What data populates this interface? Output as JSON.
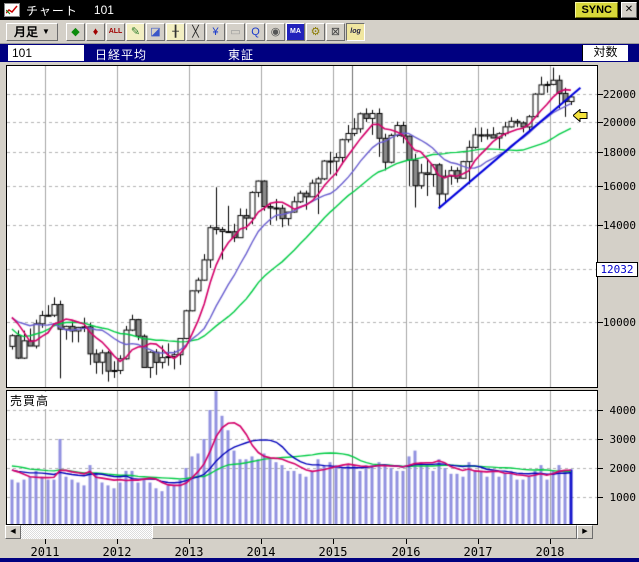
{
  "window": {
    "app_title": "チャート",
    "title_code": "101",
    "sync_label": "SYNC",
    "close_glyph": "✕"
  },
  "toolbar": {
    "interval_label": "月足",
    "dropdown_arrow": "▼",
    "icons": [
      {
        "name": "bar-width-expand-icon",
        "glyph": "◆",
        "color": "#0b8a0b",
        "bg": "#d4d0c8"
      },
      {
        "name": "bar-width-shrink-icon",
        "glyph": "♦",
        "color": "#a00000",
        "bg": "#d4d0c8"
      },
      {
        "name": "show-all-icon",
        "glyph": "ALL",
        "color": "#a00000",
        "bg": "#d4d0c8",
        "small": true
      },
      {
        "name": "draw-pencil-icon",
        "glyph": "✎",
        "color": "#2a7a2a",
        "bg": "#f3efc2"
      },
      {
        "name": "eraser-icon",
        "glyph": "◪",
        "color": "#3a56c8",
        "bg": "#d4d0c8"
      },
      {
        "name": "grid-cross-icon",
        "glyph": "╂",
        "color": "#333333",
        "bg": "#f3efc2"
      },
      {
        "name": "trendline-tool-icon",
        "glyph": "╳",
        "color": "#222222",
        "bg": "#d4d0c8"
      },
      {
        "name": "yen-scale-icon",
        "glyph": "¥",
        "color": "#1a3acc",
        "bg": "#d4d0c8"
      },
      {
        "name": "slider-icon",
        "glyph": "▭",
        "color": "#9a9a9a",
        "bg": "#d4d0c8"
      },
      {
        "name": "zoom-search-icon",
        "glyph": "Q",
        "color": "#1a3acc",
        "bg": "#d4d0c8"
      },
      {
        "name": "globe-settings-icon",
        "glyph": "◉",
        "color": "#555555",
        "bg": "#d4d0c8"
      },
      {
        "name": "ma-icon",
        "glyph": "MA",
        "color": "#ffffff",
        "bg": "#2222bb",
        "small": true
      },
      {
        "name": "settings-gears-icon",
        "glyph": "⚙",
        "color": "#8a7a00",
        "bg": "#d4d0c8"
      },
      {
        "name": "flag-tool-icon",
        "glyph": "⊠",
        "color": "#444444",
        "bg": "#d4d0c8"
      },
      {
        "name": "log-scale-icon",
        "glyph": "log",
        "color": "#222244",
        "bg": "#f0e6a0",
        "small": true,
        "pressed": true
      }
    ]
  },
  "header": {
    "code": "101",
    "name": "日経平均",
    "exchange": "東証",
    "scale_label": "対数"
  },
  "volume_panel": {
    "label": "売買高"
  },
  "scrollbar": {
    "left_arrow": "◀",
    "right_arrow": "▶"
  },
  "chart_data": {
    "type": "candlestick+volume",
    "title": "日経平均 月足 東証 (対数)",
    "scale": "log",
    "start": "2010-07",
    "ohlcv": [
      [
        9191,
        9585,
        9091,
        9537,
        1600
      ],
      [
        9537,
        9714,
        8796,
        8824,
        1500
      ],
      [
        8824,
        9704,
        8797,
        9369,
        1600
      ],
      [
        9369,
        9777,
        9202,
        9202,
        1700
      ],
      [
        9202,
        10080,
        9123,
        9937,
        1900
      ],
      [
        9937,
        10394,
        9800,
        10229,
        1700
      ],
      [
        10229,
        10600,
        10183,
        10237,
        1600
      ],
      [
        10237,
        10891,
        10175,
        10624,
        1600
      ],
      [
        10624,
        10768,
        8227,
        9755,
        3000
      ],
      [
        9755,
        9870,
        9405,
        9850,
        1700
      ],
      [
        9850,
        10017,
        9318,
        9694,
        1600
      ],
      [
        9694,
        9830,
        9319,
        9816,
        1500
      ],
      [
        9816,
        10151,
        9659,
        9833,
        1400
      ],
      [
        9833,
        9980,
        8619,
        8955,
        2100
      ],
      [
        8955,
        9098,
        8360,
        8700,
        1800
      ],
      [
        8700,
        9086,
        8343,
        8988,
        1500
      ],
      [
        8988,
        9050,
        8135,
        8435,
        1400
      ],
      [
        8435,
        8729,
        8239,
        8455,
        1300
      ],
      [
        8455,
        8911,
        8349,
        8803,
        1500
      ],
      [
        8803,
        9866,
        8780,
        9723,
        1900
      ],
      [
        9723,
        10255,
        9688,
        10084,
        1900
      ],
      [
        10084,
        10109,
        9388,
        9521,
        1500
      ],
      [
        9521,
        9580,
        8530,
        8543,
        1600
      ],
      [
        8543,
        9036,
        8238,
        9007,
        1500
      ],
      [
        9007,
        9104,
        8328,
        8695,
        1300
      ],
      [
        8695,
        9222,
        8513,
        8840,
        1200
      ],
      [
        8840,
        9288,
        8596,
        8870,
        1400
      ],
      [
        8870,
        9055,
        8488,
        8928,
        1400
      ],
      [
        8928,
        9446,
        8620,
        9446,
        1600
      ],
      [
        9446,
        10433,
        9420,
        10395,
        2000
      ],
      [
        10395,
        11150,
        10380,
        11139,
        2400
      ],
      [
        11139,
        11662,
        11046,
        11559,
        2500
      ],
      [
        11559,
        12650,
        11542,
        12398,
        3000
      ],
      [
        12398,
        13983,
        12056,
        13861,
        4000
      ],
      [
        13861,
        15943,
        13541,
        13775,
        4650
      ],
      [
        13775,
        13889,
        12415,
        13677,
        3800
      ],
      [
        13677,
        14953,
        13613,
        13668,
        3300
      ],
      [
        13668,
        14050,
        13188,
        13389,
        2600
      ],
      [
        13389,
        14817,
        13380,
        14456,
        2300
      ],
      [
        14456,
        14799,
        13748,
        14328,
        2300
      ],
      [
        14328,
        15727,
        14026,
        15662,
        2400
      ],
      [
        15662,
        16320,
        15407,
        16291,
        2300
      ],
      [
        16291,
        16330,
        14699,
        14915,
        2500
      ],
      [
        14915,
        15080,
        13995,
        14841,
        2300
      ],
      [
        14841,
        15312,
        14203,
        14828,
        2200
      ],
      [
        14828,
        15004,
        13885,
        14304,
        2100
      ],
      [
        14304,
        14637,
        13964,
        14632,
        1900
      ],
      [
        14632,
        15442,
        14601,
        15162,
        1900
      ],
      [
        15162,
        15759,
        15101,
        15621,
        1800
      ],
      [
        15621,
        15760,
        14753,
        15425,
        1700
      ],
      [
        15425,
        16374,
        15421,
        16174,
        1900
      ],
      [
        16174,
        16533,
        14529,
        16414,
        2300
      ],
      [
        16414,
        17520,
        16345,
        17460,
        2100
      ],
      [
        17460,
        18030,
        16672,
        17451,
        2200
      ],
      [
        17451,
        17951,
        16592,
        17674,
        2100
      ],
      [
        17674,
        18865,
        17268,
        18798,
        2000
      ],
      [
        18798,
        19778,
        18617,
        19207,
        2100
      ],
      [
        19207,
        20252,
        19034,
        19520,
        2100
      ],
      [
        19520,
        20655,
        19257,
        20563,
        1900
      ],
      [
        20563,
        20952,
        19990,
        20236,
        2100
      ],
      [
        20236,
        20841,
        19115,
        20585,
        2100
      ],
      [
        20585,
        20946,
        17714,
        18890,
        2200
      ],
      [
        18890,
        19192,
        16901,
        17388,
        2100
      ],
      [
        17388,
        19202,
        17320,
        19083,
        2000
      ],
      [
        19083,
        20012,
        18976,
        19747,
        1900
      ],
      [
        19747,
        20012,
        18565,
        19034,
        1900
      ],
      [
        19034,
        19058,
        16017,
        17518,
        2400
      ],
      [
        17518,
        17905,
        14865,
        16027,
        2600
      ],
      [
        16027,
        17291,
        15857,
        16759,
        2200
      ],
      [
        16759,
        17613,
        15471,
        16666,
        2100
      ],
      [
        16666,
        17251,
        15975,
        17235,
        1900
      ],
      [
        17235,
        17335,
        14864,
        15576,
        2300
      ],
      [
        15576,
        16938,
        15106,
        16569,
        2000
      ],
      [
        16569,
        17156,
        16083,
        16887,
        1800
      ],
      [
        16887,
        17081,
        16201,
        16450,
        1800
      ],
      [
        16450,
        17473,
        16436,
        17425,
        1700
      ],
      [
        17425,
        18746,
        16111,
        18308,
        2200
      ],
      [
        18308,
        19592,
        18224,
        19114,
        1900
      ],
      [
        19114,
        19615,
        18650,
        19041,
        1900
      ],
      [
        19041,
        19519,
        18805,
        19119,
        1700
      ],
      [
        19119,
        19633,
        18909,
        18909,
        1900
      ],
      [
        18909,
        19289,
        18224,
        19197,
        1700
      ],
      [
        19197,
        19998,
        19021,
        19651,
        1800
      ],
      [
        19651,
        20318,
        19610,
        20033,
        1900
      ],
      [
        20033,
        20195,
        19655,
        19925,
        1600
      ],
      [
        19925,
        20038,
        19280,
        19646,
        1600
      ],
      [
        19646,
        20481,
        19239,
        20356,
        1700
      ],
      [
        20356,
        22086,
        20328,
        22012,
        1900
      ],
      [
        22012,
        23382,
        21972,
        22725,
        2100
      ],
      [
        22725,
        23005,
        22119,
        22765,
        1600
      ],
      [
        22765,
        24129,
        22700,
        23098,
        1900
      ],
      [
        23098,
        23498,
        20950,
        22068,
        2100
      ],
      [
        22068,
        22502,
        20347,
        21454,
        1900
      ],
      [
        21454,
        21900,
        21200,
        21800,
        1950
      ]
    ],
    "ma_price": {
      "short_period": 6,
      "mid_period": 12,
      "long_period": 24,
      "seed_closes": [
        13377,
        13073,
        11260,
        8577,
        8512,
        8860,
        7994,
        7568,
        8110,
        8828,
        9523,
        9958,
        10357,
        10493,
        10133,
        10035,
        9346,
        10546,
        10198,
        10126,
        11090,
        11057,
        9769,
        9383
      ]
    },
    "ma_volume": {
      "short_period": 6,
      "mid_period": 12,
      "long_period": 24,
      "seed_volumes": [
        2300,
        2100,
        2500,
        2800,
        2300,
        2200,
        2000,
        1800,
        2200,
        2100,
        2200,
        2300,
        2100,
        2000,
        1900,
        2000,
        1900,
        1800,
        1900,
        1900,
        2100,
        2200,
        2000,
        1800
      ]
    },
    "y_ticks": [
      22000,
      20000,
      18000,
      16000,
      14000,
      10000
    ],
    "y_marker_label": "12032",
    "y_marker_value": 12032,
    "volume_ticks": [
      4000,
      3000,
      2000,
      1000
    ],
    "years": [
      "2011",
      "2012",
      "2013",
      "2014",
      "2015",
      "2016",
      "2017",
      "2018"
    ],
    "trend_line": {
      "from_month": 71,
      "from_price": 14820,
      "to_month": 94.6,
      "to_price": 22500
    },
    "marker_vline_month": 56.6,
    "cursor_marker_price": 20500,
    "colors": {
      "up_body": "#ffffff",
      "down_body": "#8b8b8b",
      "outline": "#000000",
      "ma_short": "#d4006a",
      "ma_mid_price": "#6a5fd0",
      "ma_long": "#00cc44",
      "vol_bar": "#9191e0",
      "vol_bar_last": "#1515cc",
      "vol_ma_mid": "#0000bb",
      "trend": "#0000dd",
      "grid_dash": "#b4b4b4",
      "grid_year": "#a6a6a6",
      "grid_marker": "#6e6e6e"
    }
  }
}
